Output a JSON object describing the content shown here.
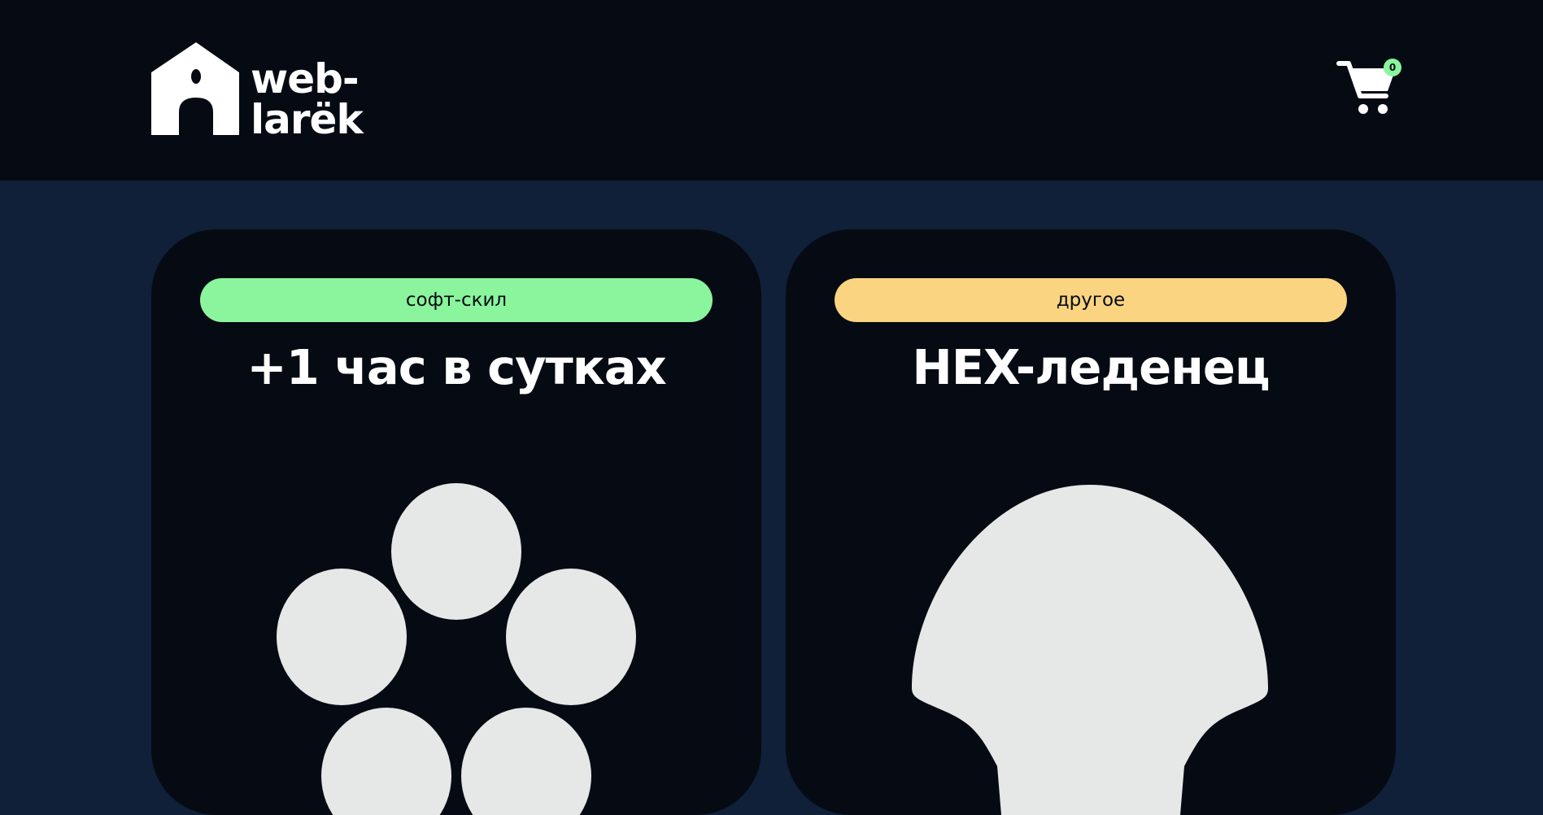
{
  "header": {
    "logo": {
      "line1": "web-",
      "line2": "larёk"
    },
    "cart": {
      "counter": "0"
    }
  },
  "gallery": {
    "cards": [
      {
        "category": "софт-скил",
        "category_color": "#8af59d",
        "title": "+1 час в сутках",
        "image_icon": "flower-icon"
      },
      {
        "category": "другое",
        "category_color": "#fad480",
        "title": "HEX-леденец",
        "image_icon": "lollipop-icon"
      }
    ]
  },
  "colors": {
    "header_bg": "#060b13",
    "page_bg": "#0f2038",
    "card_bg": "#060b13",
    "image_fill": "#e6e7e7"
  }
}
